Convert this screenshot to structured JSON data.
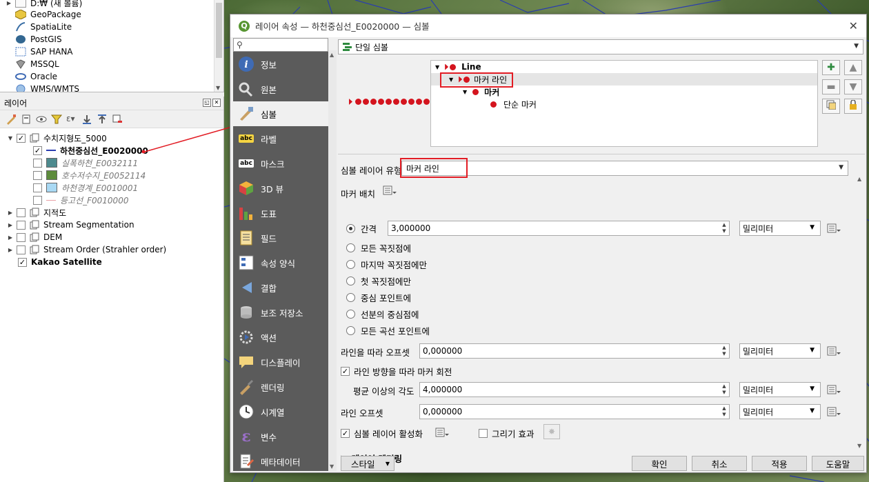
{
  "browser": {
    "items": [
      {
        "label": "D:₩ (새 볼륨)"
      },
      {
        "label": "GeoPackage"
      },
      {
        "label": "SpatiaLite"
      },
      {
        "label": "PostGIS"
      },
      {
        "label": "SAP HANA"
      },
      {
        "label": "MSSQL"
      },
      {
        "label": "Oracle"
      },
      {
        "label": "WMS/WMTS"
      }
    ]
  },
  "layers": {
    "title": "레이어",
    "tree": [
      {
        "label": "수치지형도_5000",
        "checked": true,
        "group": true
      },
      {
        "label": "하천중심선_E0020000",
        "checked": true,
        "bold": true
      },
      {
        "label": "실폭하천_E0032111",
        "checked": false,
        "swatch": "#4d8a8e"
      },
      {
        "label": "호수저수지_E0052114",
        "checked": false,
        "swatch": "#5d8b3c"
      },
      {
        "label": "하천경계_E0010001",
        "checked": false,
        "swatch": "#a9d9f4"
      },
      {
        "label": "등고선_F0010000",
        "checked": false
      },
      {
        "label": "지적도",
        "checked": false,
        "group": true
      },
      {
        "label": "Stream Segmentation",
        "checked": false,
        "group": true
      },
      {
        "label": "DEM",
        "checked": false,
        "group": true
      },
      {
        "label": "Stream Order (Strahler order)",
        "checked": false,
        "group": true
      },
      {
        "label": "Kakao Satellite",
        "checked": true,
        "bold": true
      }
    ]
  },
  "dialog": {
    "title": "레이어 속성 — 하천중심선_E0020000 — 심볼",
    "nav": [
      {
        "label": "정보",
        "icon": "info-icon"
      },
      {
        "label": "원본",
        "icon": "source-icon"
      },
      {
        "label": "심볼",
        "icon": "symbology-icon",
        "active": true
      },
      {
        "label": "라벨",
        "icon": "labels-icon"
      },
      {
        "label": "마스크",
        "icon": "mask-icon"
      },
      {
        "label": "3D 뷰",
        "icon": "3d-view-icon"
      },
      {
        "label": "도표",
        "icon": "diagram-icon"
      },
      {
        "label": "필드",
        "icon": "fields-icon"
      },
      {
        "label": "속성 양식",
        "icon": "attributes-form-icon"
      },
      {
        "label": "결합",
        "icon": "joins-icon"
      },
      {
        "label": "보조 저장소",
        "icon": "auxiliary-storage-icon"
      },
      {
        "label": "액션",
        "icon": "actions-icon"
      },
      {
        "label": "디스플레이",
        "icon": "display-icon"
      },
      {
        "label": "렌더링",
        "icon": "rendering-icon"
      },
      {
        "label": "시계열",
        "icon": "temporal-icon"
      },
      {
        "label": "변수",
        "icon": "variables-icon"
      },
      {
        "label": "메타데이터",
        "icon": "metadata-icon"
      }
    ],
    "renderer": "단일 심볼",
    "symbol_tree": {
      "root": "Line",
      "layer": "마커 라인",
      "marker": "마커",
      "simple_marker": "단순 마커"
    },
    "symbol_layer_type_label": "심볼 레이어 유형",
    "symbol_layer_type": "마커 라인",
    "marker_placement_label": "마커 배치",
    "interval_label": "간격",
    "interval_value": "3,000000",
    "interval_unit": "밀리미터",
    "placements": [
      "모든 꼭짓점에",
      "마지막 꼭짓점에만",
      "첫 꼭짓점에만",
      "중심 포인트에",
      "선분의 중심점에",
      "모든 곡선 포인트에"
    ],
    "offset_along_label": "라인을 따라 오프셋",
    "offset_along_value": "0,000000",
    "offset_along_unit": "밀리미터",
    "rotate_label": "라인 방향을 따라 마커 회전",
    "avg_angle_label": "평균 이상의 각도",
    "avg_angle_value": "4,000000",
    "avg_angle_unit": "밀리미터",
    "line_offset_label": "라인 오프셋",
    "line_offset_value": "0,000000",
    "line_offset_unit": "밀리미터",
    "enable_label": "심볼 레이어 활성화",
    "draw_effects_label": "그리기 효과",
    "layer_rendering_label": "레이어 렌더링",
    "buttons": {
      "style": "스타일",
      "ok": "확인",
      "cancel": "취소",
      "apply": "적용",
      "help": "도움말"
    }
  },
  "colors": {
    "accent_red": "#e21c24",
    "marker_red": "#d4141e",
    "nav_bg": "#5b5b5b"
  }
}
